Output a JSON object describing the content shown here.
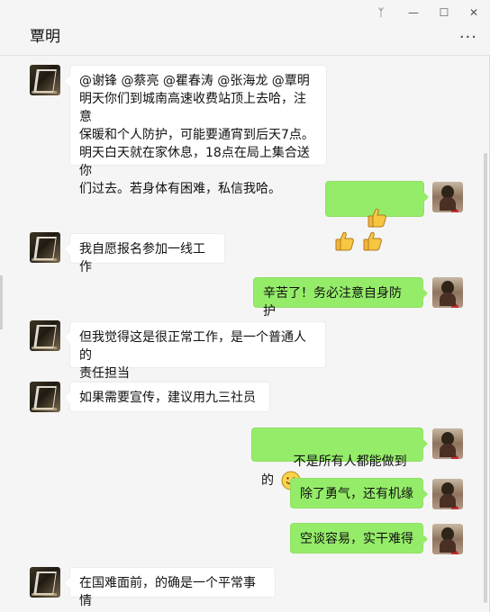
{
  "window": {
    "title": "覃明",
    "controls": {
      "pin": "ᛉ",
      "minimize": "—",
      "maximize": "☐",
      "close": "✕"
    },
    "more_label": "..."
  },
  "messages": [
    {
      "side": "left",
      "text": "@谢锋 @蔡亮 @瞿春涛 @张海龙 @覃明\n明天你们到城南高速收费站顶上去哈，注意\n保暖和个人防护，可能要通宵到后天7点。\n明天白天就在家休息，18点在局上集合送你\n们过去。若身体有困难，私信我哈。"
    },
    {
      "side": "right",
      "emoji": [
        "thumbs-up",
        "thumbs-up",
        "thumbs-up"
      ]
    },
    {
      "side": "left",
      "text": "我自愿报名参加一线工作"
    },
    {
      "side": "right",
      "text": "辛苦了！务必注意自身防护"
    },
    {
      "side": "left",
      "text": "但我觉得这是很正常工作，是一个普通人的\n责任担当"
    },
    {
      "side": "left",
      "text": "如果需要宣传，建议用九三社员"
    },
    {
      "side": "right",
      "text": "不是所有人都能做到的"
    },
    {
      "side": "right",
      "text": "除了勇气，还有机缘"
    },
    {
      "side": "right",
      "text": "空谈容易，实干难得"
    },
    {
      "side": "left",
      "text": "在国难面前，的确是一个平常事情"
    }
  ],
  "colors": {
    "sent_bubble": "#95ec69",
    "received_bubble": "#ffffff",
    "background": "#f5f5f5"
  }
}
